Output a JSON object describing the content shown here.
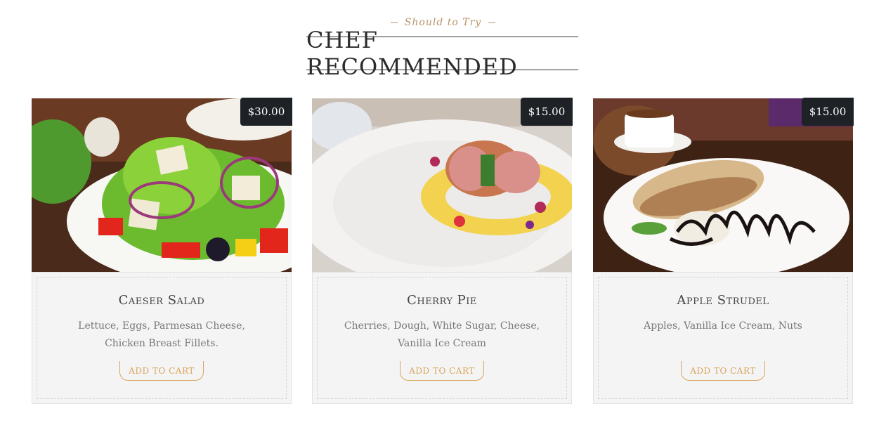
{
  "section": {
    "subtitle": "Should to Try",
    "title": "CHEF RECOMMENDED"
  },
  "dishes": [
    {
      "name": "Caeser Salad",
      "description": "Lettuce, Eggs, Parmesan Cheese, Chicken Breast Fillets.",
      "price": "$30.00",
      "button": "ADD TO CART",
      "icon": "caesar-salad-photo"
    },
    {
      "name": "Cherry Pie",
      "description": "Cherries, Dough, White Sugar, Cheese, Vanilla Ice Cream",
      "price": "$15.00",
      "button": "ADD TO CART",
      "icon": "cherry-pie-photo"
    },
    {
      "name": "Apple Strudel",
      "description": "Apples, Vanilla Ice Cream, Nuts",
      "price": "$15.00",
      "button": "ADD TO CART",
      "icon": "apple-strudel-photo"
    }
  ],
  "colors": {
    "accent": "#d9a55c",
    "price_badge": "#1e2125",
    "card_bg": "#f4f4f4"
  }
}
